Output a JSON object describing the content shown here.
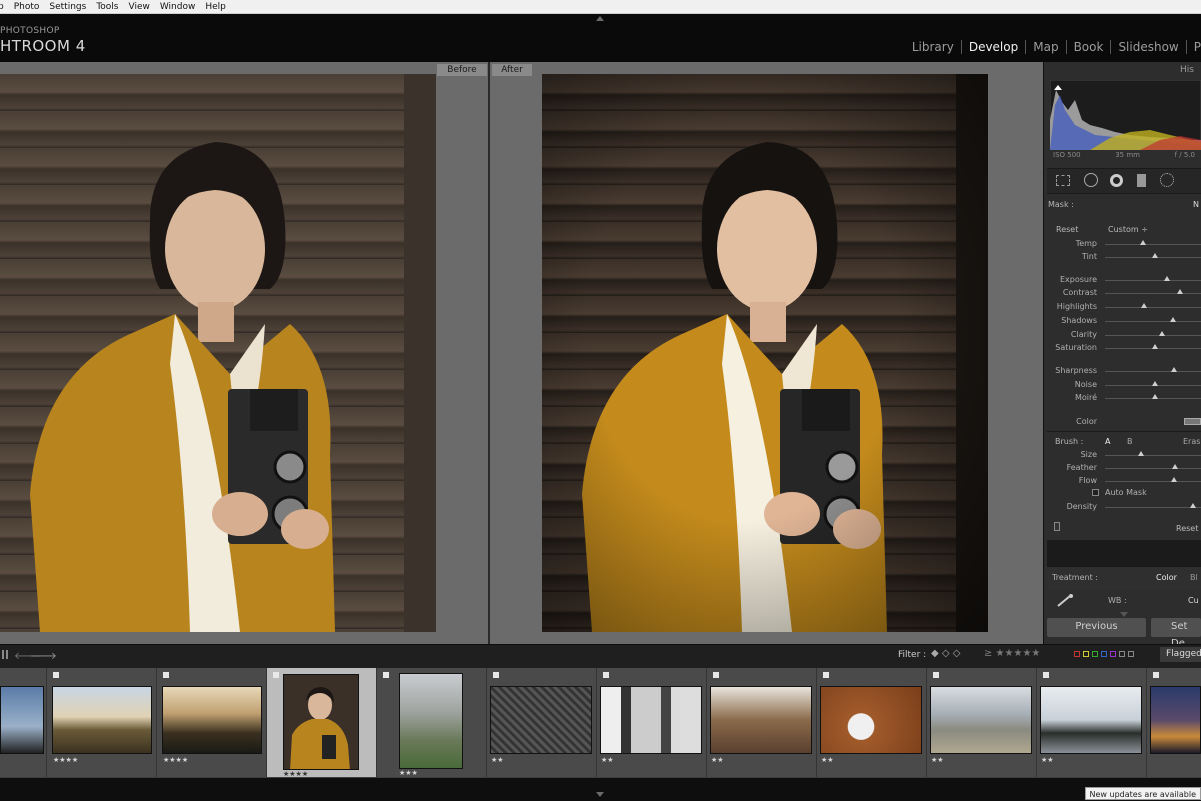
{
  "menubar": {
    "items": [
      "p",
      "Photo",
      "Settings",
      "Tools",
      "View",
      "Window",
      "Help"
    ]
  },
  "brand": {
    "small": "PHOTOSHOP",
    "big": "HTROOM 4"
  },
  "modules": [
    {
      "label": "Library",
      "active": false
    },
    {
      "label": "Develop",
      "active": true
    },
    {
      "label": "Map",
      "active": false
    },
    {
      "label": "Book",
      "active": false
    },
    {
      "label": "Slideshow",
      "active": false
    },
    {
      "label": "P",
      "active": false
    }
  ],
  "view": {
    "before_label": "Before",
    "after_label": "After"
  },
  "panel": {
    "histogram_title": "His",
    "histogram_info": {
      "iso": "ISO 500",
      "focal": "35 mm",
      "aperture": "f / 5.0"
    },
    "mask_label": "Mask :",
    "mask_value": "N",
    "reset_label": "Reset",
    "preset_value": "Custom ÷",
    "sliders": [
      {
        "label": "Temp",
        "value": 0.4
      },
      {
        "label": "Tint",
        "value": 0.52
      },
      {
        "label": "Exposure",
        "value": 0.65
      },
      {
        "label": "Contrast",
        "value": 0.78
      },
      {
        "label": "Highlights",
        "value": 0.41
      },
      {
        "label": "Shadows",
        "value": 0.71
      },
      {
        "label": "Clarity",
        "value": 0.59
      },
      {
        "label": "Saturation",
        "value": 0.52
      },
      {
        "label": "Sharpness",
        "value": 0.72
      },
      {
        "label": "Noise",
        "value": 0.52
      },
      {
        "label": "Moiré",
        "value": 0.52
      }
    ],
    "color_label": "Color",
    "brush_label": "Brush :",
    "brush_a": "A",
    "brush_b": "B",
    "brush_erase": "Eras",
    "brush_sliders": [
      {
        "label": "Size",
        "value": 0.37
      },
      {
        "label": "Feather",
        "value": 0.73
      },
      {
        "label": "Flow",
        "value": 0.72
      }
    ],
    "auto_mask_label": "Auto Mask",
    "density_label": "Density",
    "density_value": 0.92,
    "reset_button": "Reset",
    "treatment_label": "Treatment :",
    "treatment_color": "Color",
    "treatment_bw": "Bl",
    "wb_label": "WB :",
    "wb_value": "Cu",
    "previous_button": "Previous",
    "set_default_button": "Set De"
  },
  "toolbar": {
    "filter_label": "Filter :",
    "rating_filter": "≥ ★★★★★",
    "flagged_label": "Flagged"
  },
  "filmstrip": {
    "thumbs": [
      {
        "stars": "",
        "selected": false
      },
      {
        "stars": "★★★★",
        "selected": false
      },
      {
        "stars": "★★★★",
        "selected": false
      },
      {
        "stars": "★★★★",
        "selected": true
      },
      {
        "stars": "★★★",
        "selected": false
      },
      {
        "stars": "★★",
        "selected": false
      },
      {
        "stars": "★★",
        "selected": false
      },
      {
        "stars": "★★",
        "selected": false
      },
      {
        "stars": "★★",
        "selected": false
      },
      {
        "stars": "★★",
        "selected": false
      },
      {
        "stars": "★★",
        "selected": false
      },
      {
        "stars": "",
        "selected": false
      }
    ]
  },
  "status": {
    "updates": "New updates are available"
  },
  "colors": {
    "accent": "#f0f0f0",
    "panel": "#2d2d2d",
    "bg": "#6b6b6b"
  }
}
